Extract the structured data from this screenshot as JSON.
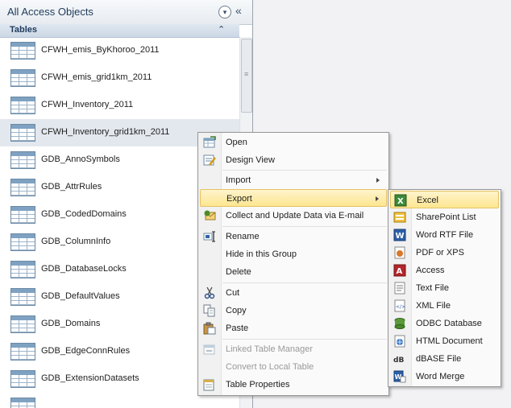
{
  "nav": {
    "title": "All Access Objects",
    "menu_glyph": "▾",
    "collapse_glyph": "«",
    "group_title": "Tables",
    "group_chevron": "⌃",
    "scroll_grip": "≡",
    "tables": [
      "CFWH_emis_ByKhoroo_2011",
      "CFWH_emis_grid1km_2011",
      "CFWH_Inventory_2011",
      "CFWH_Inventory_grid1km_2011",
      "GDB_AnnoSymbols",
      "GDB_AttrRules",
      "GDB_CodedDomains",
      "GDB_ColumnInfo",
      "GDB_DatabaseLocks",
      "GDB_DefaultValues",
      "GDB_Domains",
      "GDB_EdgeConnRules",
      "GDB_ExtensionDatasets"
    ]
  },
  "context_menu": {
    "items": [
      {
        "label": "Open",
        "icon": "open-table-icon"
      },
      {
        "label": "Design View",
        "icon": "design-view-icon"
      },
      {
        "label": "Import",
        "icon": "",
        "submenu": true
      },
      {
        "label": "Export",
        "icon": "",
        "submenu": true,
        "highlighted": true
      },
      {
        "label": "Collect and Update Data via E-mail",
        "icon": "collect-email-icon"
      },
      {
        "label": "Rename",
        "icon": "rename-icon"
      },
      {
        "label": "Hide in this Group",
        "icon": ""
      },
      {
        "label": "Delete",
        "icon": ""
      },
      {
        "label": "Cut",
        "icon": "scissors-icon"
      },
      {
        "label": "Copy",
        "icon": "copy-icon"
      },
      {
        "label": "Paste",
        "icon": "paste-icon"
      },
      {
        "label": "Linked Table Manager",
        "icon": "linked-table-icon",
        "disabled": true
      },
      {
        "label": "Convert to Local Table",
        "icon": "",
        "disabled": true
      },
      {
        "label": "Table Properties",
        "icon": "table-properties-icon"
      }
    ]
  },
  "export_menu": {
    "items": [
      {
        "label": "Excel",
        "icon": "excel-icon"
      },
      {
        "label": "SharePoint List",
        "icon": "sharepoint-icon"
      },
      {
        "label": "Word RTF File",
        "icon": "word-icon"
      },
      {
        "label": "PDF or XPS",
        "icon": "pdf-icon"
      },
      {
        "label": "Access",
        "icon": "access-icon"
      },
      {
        "label": "Text File",
        "icon": "text-file-icon"
      },
      {
        "label": "XML File",
        "icon": "xml-icon"
      },
      {
        "label": "ODBC Database",
        "icon": "odbc-icon"
      },
      {
        "label": "HTML Document",
        "icon": "html-icon"
      },
      {
        "label": "dBASE File",
        "icon": "dbase-icon"
      },
      {
        "label": "Word Merge",
        "icon": "word-merge-icon"
      }
    ]
  },
  "colors": {
    "nav_title": "#1f3a5c",
    "menu_highlight": "#fde690",
    "selected_row": "#e3e8ee"
  }
}
